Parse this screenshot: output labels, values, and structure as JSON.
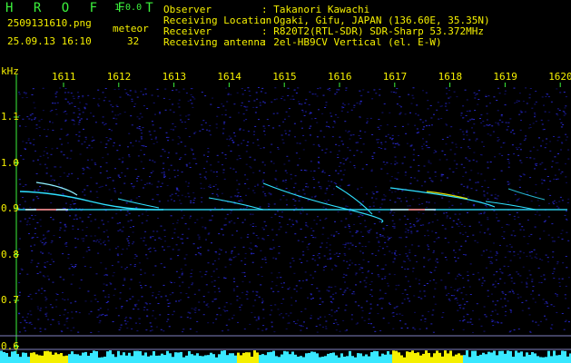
{
  "header": {
    "title": "H R O F F T",
    "version": "1.0.0",
    "filename": "2509131610.png",
    "timestamp": "25.09.13 16:10",
    "meteor_label": "meteor",
    "meteor_count": "32"
  },
  "info": [
    {
      "key": "Observer",
      "value": ": Takanori Kawachi"
    },
    {
      "key": "Receiving Location",
      "value": ": Ogaki, Gifu, JAPAN (136.60E, 35.35N)"
    },
    {
      "key": "Receiver",
      "value": ": R820T2(RTL-SDR) SDR-Sharp 53.372MHz"
    },
    {
      "key": "Receiving antenna",
      "value": ": 2el-HB9CV Vertical (el. E-W)"
    }
  ],
  "axis": {
    "y_unit": "kHz",
    "x_ticks": [
      "1611",
      "1612",
      "1613",
      "1614",
      "1615",
      "1616",
      "1617",
      "1618",
      "1619",
      "1620"
    ],
    "y_ticks": [
      "1.1",
      "1.0",
      "0.9",
      "0.8",
      "0.7",
      "0.6"
    ]
  },
  "colors": {
    "text": "#3cf23c",
    "header_value": "#38e8ff",
    "highlight": "#f5f000",
    "background": "#000000",
    "noise": "#1c1c9a",
    "trace": "#2fe0ff"
  }
}
